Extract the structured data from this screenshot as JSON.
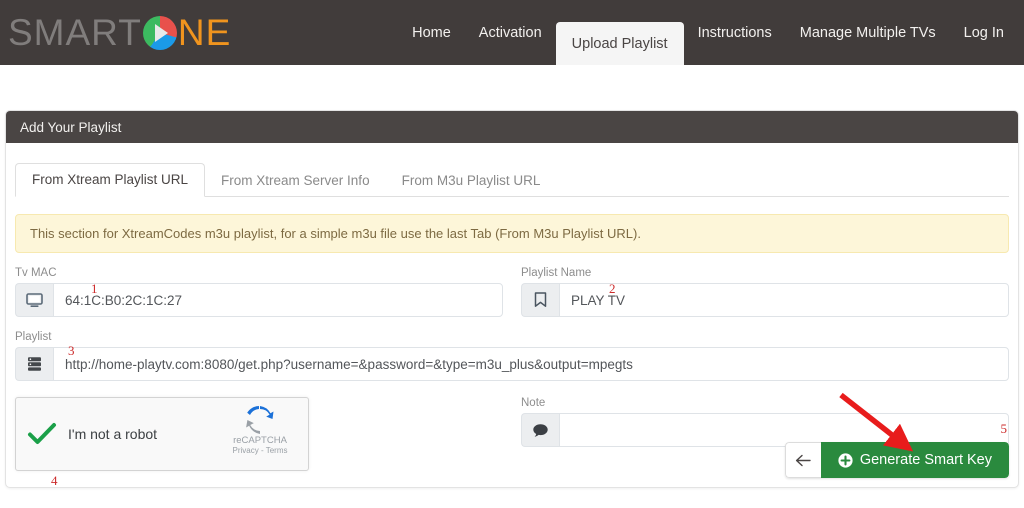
{
  "navbar": {
    "brand": {
      "part1": "SMART",
      "logo_icon": "pie-play-logo",
      "part2": "NE"
    },
    "links": [
      {
        "label": "Home",
        "active": false
      },
      {
        "label": "Activation",
        "active": false
      },
      {
        "label": "Upload Playlist",
        "active": true
      },
      {
        "label": "Instructions",
        "active": false
      },
      {
        "label": "Manage Multiple TVs",
        "active": false
      },
      {
        "label": "Log In",
        "active": false
      }
    ]
  },
  "card": {
    "header_title": "Add Your Playlist",
    "tabs": [
      {
        "label": "From Xtream Playlist URL",
        "active": true
      },
      {
        "label": "From Xtream Server Info",
        "active": false
      },
      {
        "label": "From M3u Playlist URL",
        "active": false
      }
    ],
    "alert": "This section for XtreamCodes m3u playlist, for a simple m3u file use the last Tab (From M3u Playlist URL).",
    "fields": {
      "tv_mac": {
        "label": "Tv MAC",
        "value": "64:1C:B0:2C:1C:27",
        "icon": "monitor-icon"
      },
      "playlist_name": {
        "label": "Playlist Name",
        "value": "PLAY TV",
        "icon": "bookmark-icon"
      },
      "playlist": {
        "label": "Playlist",
        "value": "http://home-playtv.com:8080/get.php?username=&password=&type=m3u_plus&output=mpegts",
        "icon": "server-icon"
      },
      "note": {
        "label": "Note",
        "value": "",
        "icon": "comment-icon"
      }
    },
    "recaptcha": {
      "label": "I'm not a robot",
      "brand": "reCAPTCHA",
      "privacy": "Privacy",
      "separator": "-",
      "terms": "Terms",
      "checked": true,
      "check_icon": "green-check-icon",
      "logo_icon": "recaptcha-icon"
    },
    "footer": {
      "back_label": "←",
      "back_icon": "arrow-left-icon",
      "submit_label": "Generate Smart Key",
      "submit_icon": "plus-circle-icon"
    }
  },
  "annotations": [
    {
      "id": "1",
      "text": "1"
    },
    {
      "id": "2",
      "text": "2"
    },
    {
      "id": "3",
      "text": "3"
    },
    {
      "id": "4",
      "text": "4"
    },
    {
      "id": "5",
      "text": "5"
    }
  ],
  "colors": {
    "navbar_bg": "#413c3b",
    "card_header_bg": "#4a4544",
    "accent_green": "#2a8a3e",
    "alert_bg": "#fdf6d9",
    "annotation_red": "#cc2b2b",
    "brand_orange": "#f0941e",
    "brand_gray": "#807d7c"
  }
}
